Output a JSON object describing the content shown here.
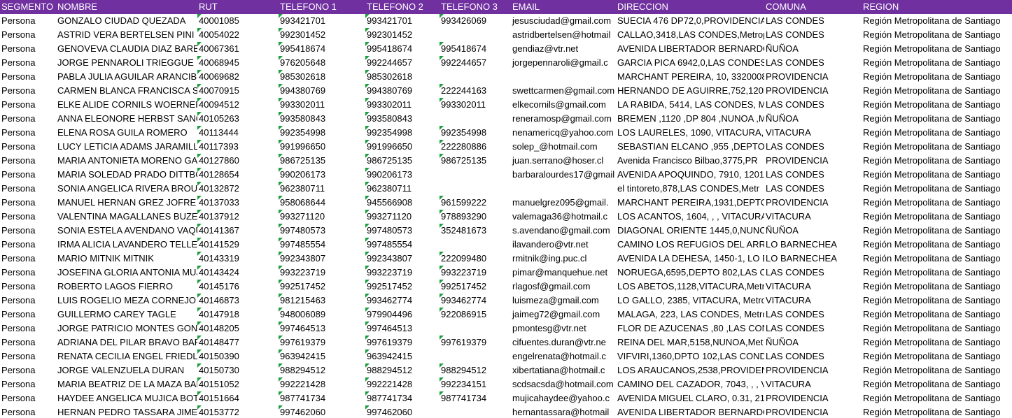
{
  "sheet": {
    "accent_color": "#7030a0",
    "error_indicator_color": "#1a9e3c",
    "headers": [
      "SEGMENTO",
      "NOMBRE",
      "RUT",
      "TELEFONO 1",
      "TELEFONO 2",
      "TELEFONO 3",
      "EMAIL",
      "DIRECCION",
      "COMUNA",
      "REGION"
    ],
    "rows": [
      [
        "Persona",
        "GONZALO CIUDAD QUEZADA",
        "40001085",
        "993421701",
        "993421701",
        "993426069",
        "jesusciudad@gmail.com",
        "SUECIA 476 DP72,0,PROVIDENCIA,",
        "LAS CONDES",
        "Región Metropolitana de Santiago"
      ],
      [
        "Persona",
        "ASTRID VERA BERTELSEN PINI",
        "40054022",
        "992301452",
        "992301452",
        "",
        "astridbertelsen@hotmail",
        "CALLAO,3418,LAS CONDES,Metrop",
        "LAS CONDES",
        "Región Metropolitana de Santiago"
      ],
      [
        "Persona",
        "GENOVEVA CLAUDIA DIAZ BARBA",
        "40067361",
        "995418674",
        "995418674",
        "995418674",
        "gendiaz@vtr.net",
        "AVENIDA LIBERTADOR BERNARDO",
        "ÑUÑOA",
        "Región Metropolitana de Santiago"
      ],
      [
        "Persona",
        "JORGE PENNAROLI TRIEGGUE",
        "40068945",
        "976205648",
        "992244657",
        "992244657",
        "jorgepennaroli@gmail.c",
        "GARCIA PICA 6942,0,LAS CONDES,I",
        "LAS CONDES",
        "Región Metropolitana de Santiago"
      ],
      [
        "Persona",
        "PABLA JULIA AGUILAR ARANCIBIA",
        "40069682",
        "985302618",
        "985302618",
        "",
        "",
        "MARCHANT PEREIRA, 10, 3320008",
        "PROVIDENCIA",
        "Región Metropolitana de Santiago"
      ],
      [
        "Persona",
        "CARMEN BLANCA FRANCISCA SWETT",
        "40070915",
        "994380769",
        "994380769",
        "222244163",
        "swettcarmen@gmail.com",
        "HERNANDO DE AGUIRRE,752,1205,",
        "PROVIDENCIA",
        "Región Metropolitana de Santiago"
      ],
      [
        "Persona",
        "ELKE ALIDE CORNILS WOERNER",
        "40094512",
        "993302011",
        "993302011",
        "993302011",
        "elkecornils@gmail.com",
        "LA RABIDA, 5414, LAS CONDES, Me",
        "LAS CONDES",
        "Región Metropolitana de Santiago"
      ],
      [
        "Persona",
        "ANNA ELEONORE HERBST SANCHEZ",
        "40105263",
        "993580843",
        "993580843",
        "",
        "reneramosp@gmail.com",
        "BREMEN ,1120 ,DP 804 ,NUNOA ,M",
        "ÑUÑOA",
        "Región Metropolitana de Santiago"
      ],
      [
        "Persona",
        "ELENA ROSA GUILA ROMERO",
        "40113444",
        "992354998",
        "992354998",
        "992354998",
        "nenamericq@yahoo.com",
        "LOS LAURELES, 1090, VITACURA, M",
        "VITACURA",
        "Región Metropolitana de Santiago"
      ],
      [
        "Persona",
        "LUCY LETICIA ADAMS JARAMILLO",
        "40117393",
        "991996650",
        "991996650",
        "222280886",
        "solep_@hotmail.com",
        "SEBASTIAN ELCANO ,955 ,DEPTO 5",
        "LAS CONDES",
        "Región Metropolitana de Santiago"
      ],
      [
        "Persona",
        "MARIA ANTONIETA MORENO GARCES",
        "40127860",
        "986725135",
        "986725135",
        "986725135",
        "juan.serrano@hoser.cl",
        "Avenida Francisco Bilbao,3775,PR",
        "PROVIDENCIA",
        "Región Metropolitana de Santiago"
      ],
      [
        "Persona",
        "MARIA SOLEDAD PRADO DITTBORN",
        "40128654",
        "990206173",
        "990206173",
        "",
        "barbaralourdes17@gmail",
        "AVENIDA APOQUINDO, 7910, 1201",
        "LAS CONDES",
        "Región Metropolitana de Santiago"
      ],
      [
        "Persona",
        "SONIA ANGELICA RIVERA BROUSSE",
        "40132872",
        "962380711",
        "962380711",
        "",
        "",
        "el tintoreto,878,LAS CONDES,Metr",
        "LAS CONDES",
        "Región Metropolitana de Santiago"
      ],
      [
        "Persona",
        "MANUEL HERNAN GREZ JOFRE",
        "40137033",
        "958068644",
        "945566908",
        "961599222",
        "manuelgrez095@gmail.",
        "MARCHANT PEREIRA,1931,DEPTO",
        "PROVIDENCIA",
        "Región Metropolitana de Santiago"
      ],
      [
        "Persona",
        "VALENTINA MAGALLANES BUZETA",
        "40137912",
        "993271120",
        "993271120",
        "978893290",
        "valemaga36@hotmail.c",
        "LOS ACANTOS, 1604, , , VITACURA",
        "VITACURA",
        "Región Metropolitana de Santiago"
      ],
      [
        "Persona",
        "SONIA ESTELA AVENDANO VAQUERO",
        "40141367",
        "997480573",
        "997480573",
        "352481673",
        "s.avendano@gmail.com",
        "DIAGONAL ORIENTE 1445,0,NUNO",
        "ÑUÑOA",
        "Región Metropolitana de Santiago"
      ],
      [
        "Persona",
        "IRMA ALICIA LAVANDERO TELLEZ",
        "40141529",
        "997485554",
        "997485554",
        "",
        "ilavandero@vtr.net",
        "CAMINO LOS REFUGIOS DEL ARRA",
        "LO BARNECHEA",
        "Región Metropolitana de Santiago"
      ],
      [
        "Persona",
        "MARIO MITNIK MITNIK",
        "40143319",
        "992343807",
        "992343807",
        "222099480",
        "rmitnik@ing.puc.cl",
        "AVENIDA LA DEHESA, 1450-1, LO B",
        "LO BARNECHEA",
        "Región Metropolitana de Santiago"
      ],
      [
        "Persona",
        "JOSEFINA GLORIA ANTONIA MUJICA",
        "40143424",
        "993223719",
        "993223719",
        "993223719",
        "pimar@manquehue.net",
        "NORUEGA,6595,DEPTO 802,LAS CO",
        "LAS CONDES",
        "Región Metropolitana de Santiago"
      ],
      [
        "Persona",
        "ROBERTO LAGOS FIERRO",
        "40145176",
        "992517452",
        "992517452",
        "992517452",
        "rlagosf@gmail.com",
        "LOS ABETOS,1128,VITACURA,Metr",
        "VITACURA",
        "Región Metropolitana de Santiago"
      ],
      [
        "Persona",
        "LUIS ROGELIO MEZA CORNEJO",
        "40146873",
        "981215463",
        "993462774",
        "993462774",
        "luismeza@gmail.com",
        "LO GALLO, 2385, VITACURA, Metro",
        "VITACURA",
        "Región Metropolitana de Santiago"
      ],
      [
        "Persona",
        "GUILLERMO CAREY TAGLE",
        "40147918",
        "948006089",
        "979904496",
        "922086915",
        "jaimeg72@gmail.com",
        "MALAGA, 223, LAS CONDES, Metro",
        "LAS CONDES",
        "Región Metropolitana de Santiago"
      ],
      [
        "Persona",
        "JORGE PATRICIO MONTES GONZALEZ",
        "40148205",
        "997464513",
        "997464513",
        "",
        "pmontesg@vtr.net",
        "FLOR DE AZUCENAS ,80 ,LAS COND",
        "LAS CONDES",
        "Región Metropolitana de Santiago"
      ],
      [
        "Persona",
        "ADRIANA DEL PILAR BRAVO BARRA",
        "40148477",
        "997619379",
        "997619379",
        "997619379",
        "cifuentes.duran@vtr.ne",
        "REINA DEL MAR,5158,NUNOA,Met",
        "ÑUÑOA",
        "Región Metropolitana de Santiago"
      ],
      [
        "Persona",
        "RENATA CECILIA ENGEL FRIEDLANDER",
        "40150390",
        "963942415",
        "963942415",
        "",
        "engelrenata@hotmail.c",
        "VIFVIRI,1360,DPTO 102,LAS COND",
        "LAS CONDES",
        "Región Metropolitana de Santiago"
      ],
      [
        "Persona",
        "JORGE VALENZUELA DURAN",
        "40150730",
        "988294512",
        "988294512",
        "988294512",
        "xibertatiana@hotmail.c",
        "LOS ARAUCANOS,2538,PROVIDEN",
        "PROVIDENCIA",
        "Región Metropolitana de Santiago"
      ],
      [
        "Persona",
        "MARIA BEATRIZ DE LA MAZA BAÑADOS",
        "40151052",
        "992221428",
        "992221428",
        "992234151",
        "scdsacsda@hotmail.com",
        "CAMINO DEL CAZADOR, 7043, , , V",
        "VITACURA",
        "Región Metropolitana de Santiago"
      ],
      [
        "Persona",
        "HAYDEE ANGELICA MUJICA BOTTARO",
        "40151664",
        "987741734",
        "987741734",
        "987741734",
        "mujicahaydee@yahoo.c",
        "AVENIDA MIGUEL CLARO, 0.31, 21,",
        "PROVIDENCIA",
        "Región Metropolitana de Santiago"
      ],
      [
        "Persona",
        "HERNAN PEDRO TASSARA JIMENEZ",
        "40153772",
        "997462060",
        "997462060",
        "",
        "hernantassara@hotmail",
        "AVENIDA LIBERTADOR BERNARDO",
        "PROVIDENCIA",
        "Región Metropolitana de Santiago"
      ]
    ]
  }
}
